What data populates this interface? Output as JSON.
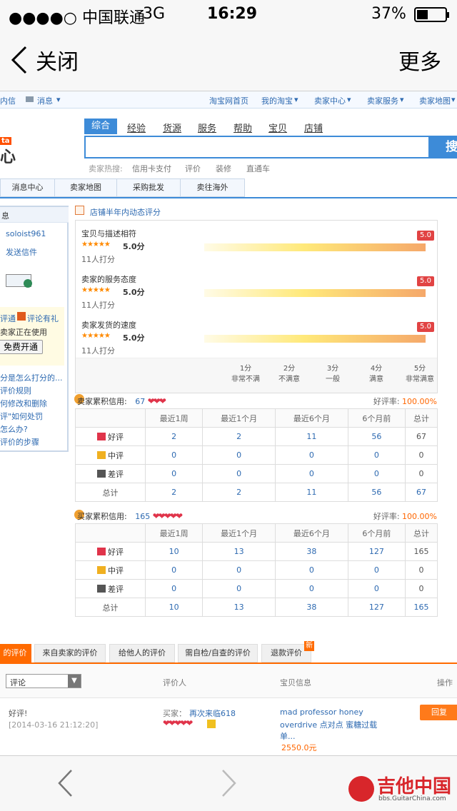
{
  "status_bar": {
    "carrier": "●●●●○ 中国联通",
    "network": "3G",
    "time": "16:29",
    "battery": "37%"
  },
  "nav_bar": {
    "back_label": "关闭",
    "more_label": "更多"
  },
  "top_nav": {
    "left": [
      "内信",
      "消息"
    ],
    "right": [
      "淘宝网首页",
      "我的淘宝",
      "卖家中心",
      "卖家服务",
      "卖家地图"
    ]
  },
  "logo": {
    "small": "ta",
    "big": "心"
  },
  "search": {
    "tabs": [
      "综合",
      "经验",
      "货源",
      "服务",
      "帮助",
      "宝贝",
      "店铺"
    ],
    "button": "搜",
    "hot_label": "卖家热搜:",
    "hot": [
      "信用卡支付",
      "评价",
      "装修",
      "直通车"
    ]
  },
  "sub_nav": [
    "消息中心",
    "卖家地图",
    "采购批发",
    "卖往海外"
  ],
  "sidebar": {
    "header": "息",
    "username": "soloist961",
    "send_letter": "发送信件",
    "promo_a": "评通",
    "promo_b": "评论有礼",
    "promo_c": "卖家正在使用",
    "free_button": "免费开通",
    "links": [
      "分是怎么打分的...",
      "评价规则",
      "何修改和删除",
      "评\"如何处罚",
      "怎么办?",
      "评价的步骤"
    ]
  },
  "dsr": {
    "title": "店铺半年内动态评分",
    "items": [
      {
        "label": "宝贝与描述相符",
        "score": "5.0分",
        "count": "11人打分",
        "badge": "5.0",
        "value": 5.0
      },
      {
        "label": "卖家的服务态度",
        "score": "5.0分",
        "count": "11人打分",
        "badge": "5.0",
        "value": 5.0
      },
      {
        "label": "卖家发货的速度",
        "score": "5.0分",
        "count": "11人打分",
        "badge": "5.0",
        "value": 5.0
      }
    ],
    "scale": [
      {
        "score": "1分",
        "label": "非常不满"
      },
      {
        "score": "2分",
        "label": "不满意"
      },
      {
        "score": "3分",
        "label": "一般"
      },
      {
        "score": "4分",
        "label": "满意"
      },
      {
        "score": "5分",
        "label": "非常满意"
      }
    ]
  },
  "seller_credit": {
    "title": "卖家累积信用:",
    "score": "67",
    "rate_label": "好评率:",
    "rate": "100.00%",
    "headers": [
      "",
      "最近1周",
      "最近1个月",
      "最近6个月",
      "6个月前",
      "总计"
    ],
    "rows": [
      {
        "label": "好评",
        "values": [
          "2",
          "2",
          "11",
          "56",
          "67"
        ]
      },
      {
        "label": "中评",
        "values": [
          "0",
          "0",
          "0",
          "0",
          "0"
        ]
      },
      {
        "label": "差评",
        "values": [
          "0",
          "0",
          "0",
          "0",
          "0"
        ]
      },
      {
        "label": "总计",
        "values": [
          "2",
          "2",
          "11",
          "56",
          "67"
        ]
      }
    ]
  },
  "buyer_credit": {
    "title": "买家累积信用:",
    "score": "165",
    "rate_label": "好评率:",
    "rate": "100.00%",
    "headers": [
      "",
      "最近1周",
      "最近1个月",
      "最近6个月",
      "6个月前",
      "总计"
    ],
    "rows": [
      {
        "label": "好评",
        "values": [
          "10",
          "13",
          "38",
          "127",
          "165"
        ]
      },
      {
        "label": "中评",
        "values": [
          "0",
          "0",
          "0",
          "0",
          "0"
        ]
      },
      {
        "label": "差评",
        "values": [
          "0",
          "0",
          "0",
          "0",
          "0"
        ]
      },
      {
        "label": "总计",
        "values": [
          "10",
          "13",
          "38",
          "127",
          "165"
        ]
      }
    ]
  },
  "bottom_tabs": [
    "的评价",
    "来自卖家的评价",
    "给他人的评价",
    "需自检/自查的评价",
    "退款评价"
  ],
  "new_badge": "新",
  "review_header": {
    "filter": "评论",
    "col_reviewer": "评价人",
    "col_item": "宝贝信息",
    "col_action": "操作"
  },
  "review": {
    "text": "好评!",
    "time": "[2014-03-16 21:12:20]",
    "reviewer_prefix": "买家：",
    "reviewer": "再次来临618",
    "item_line1": "mad professor honey",
    "item_line2": "overdrive 点对点 蜜糖过载",
    "item_line3": "单...",
    "price": "2550.0元",
    "reply_button": "回复"
  },
  "watermark": {
    "title": "吉他中国",
    "url": "bbs.GuitarChina.com"
  },
  "colors": {
    "link": "#2e6ab1",
    "accent": "#ff6600",
    "badge": "#e14343",
    "heart": "#e0344a"
  }
}
